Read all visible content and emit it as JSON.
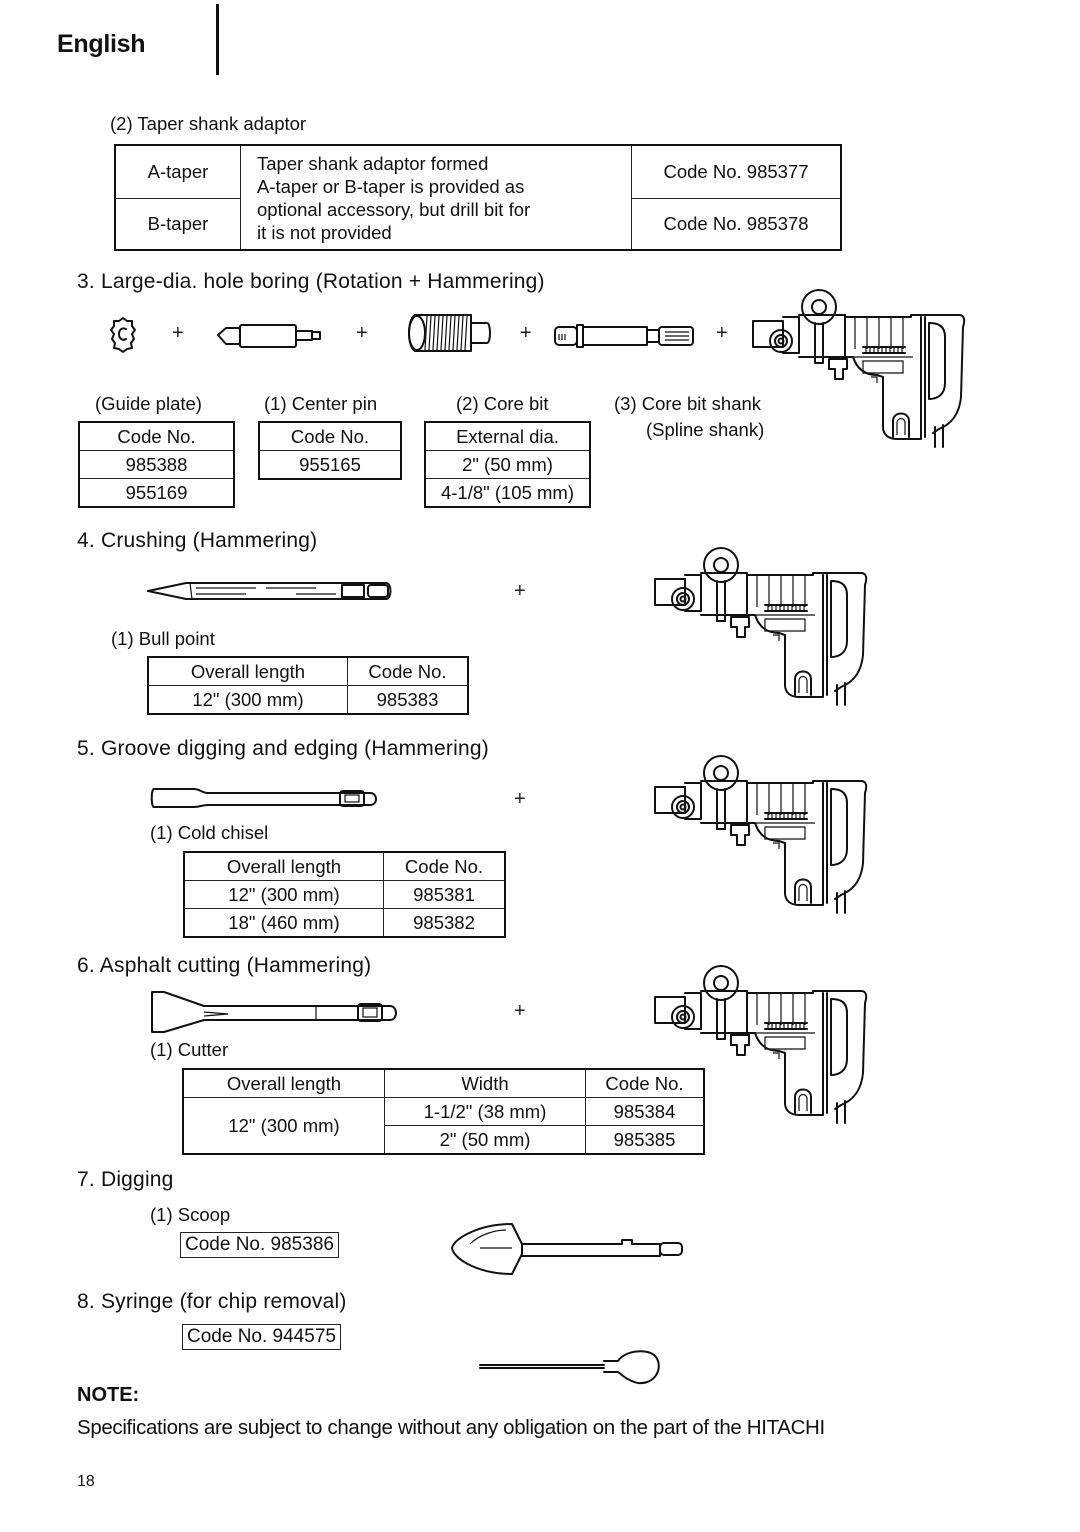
{
  "header": {
    "language": "English"
  },
  "taper_section": {
    "title": "(2) Taper shank adaptor",
    "rows": [
      {
        "type": "A-taper",
        "code": "Code No. 985377"
      },
      {
        "type": "B-taper",
        "code": "Code No. 985378"
      }
    ],
    "description_lines": [
      "Taper shank adaptor formed",
      "A-taper or B-taper is provided as",
      "optional accessory, but drill bit for",
      "it is not provided"
    ]
  },
  "section3": {
    "title": "3.  Large-dia. hole boring (Rotation + Hammering)",
    "plus": "+",
    "guide_plate": {
      "label": "(Guide plate)",
      "header": "Code No.",
      "values": [
        "985388",
        "955169"
      ]
    },
    "center_pin": {
      "label": "(1) Center pin",
      "header": "Code No.",
      "values": [
        "955165"
      ]
    },
    "core_bit": {
      "label": "(2) Core bit",
      "header": "External dia.",
      "values": [
        "2\" (50 mm)",
        "4-1/8\" (105 mm)"
      ]
    },
    "core_bit_shank": {
      "label": "(3) Core bit shank",
      "sublabel": "(Spline shank)"
    }
  },
  "section4": {
    "title": "4.  Crushing (Hammering)",
    "plus": "+",
    "item_label": "(1) Bull point",
    "headers": [
      "Overall length",
      "Code No."
    ],
    "rows": [
      [
        "12\" (300 mm)",
        "985383"
      ]
    ]
  },
  "section5": {
    "title": "5.  Groove digging and edging (Hammering)",
    "plus": "+",
    "item_label": "(1) Cold chisel",
    "headers": [
      "Overall length",
      "Code No."
    ],
    "rows": [
      [
        "12\" (300 mm)",
        "985381"
      ],
      [
        "18\" (460 mm)",
        "985382"
      ]
    ]
  },
  "section6": {
    "title": "6.  Asphalt cutting (Hammering)",
    "plus": "+",
    "item_label": "(1) Cutter",
    "headers": [
      "Overall length",
      "Width",
      "Code No."
    ],
    "length": "12\" (300 mm)",
    "rows": [
      [
        "1-1/2\" (38 mm)",
        "985384"
      ],
      [
        "2\" (50 mm)",
        "985385"
      ]
    ]
  },
  "section7": {
    "title": "7.  Digging",
    "item_label": "(1) Scoop",
    "code": "Code No. 985386"
  },
  "section8": {
    "title": "8. Syringe (for chip removal)",
    "code": "Code No. 944575"
  },
  "note": {
    "heading": "NOTE:",
    "text": "Specifications are subject to change without any obligation on the part of the HITACHI"
  },
  "footer": {
    "page_number": "18"
  }
}
